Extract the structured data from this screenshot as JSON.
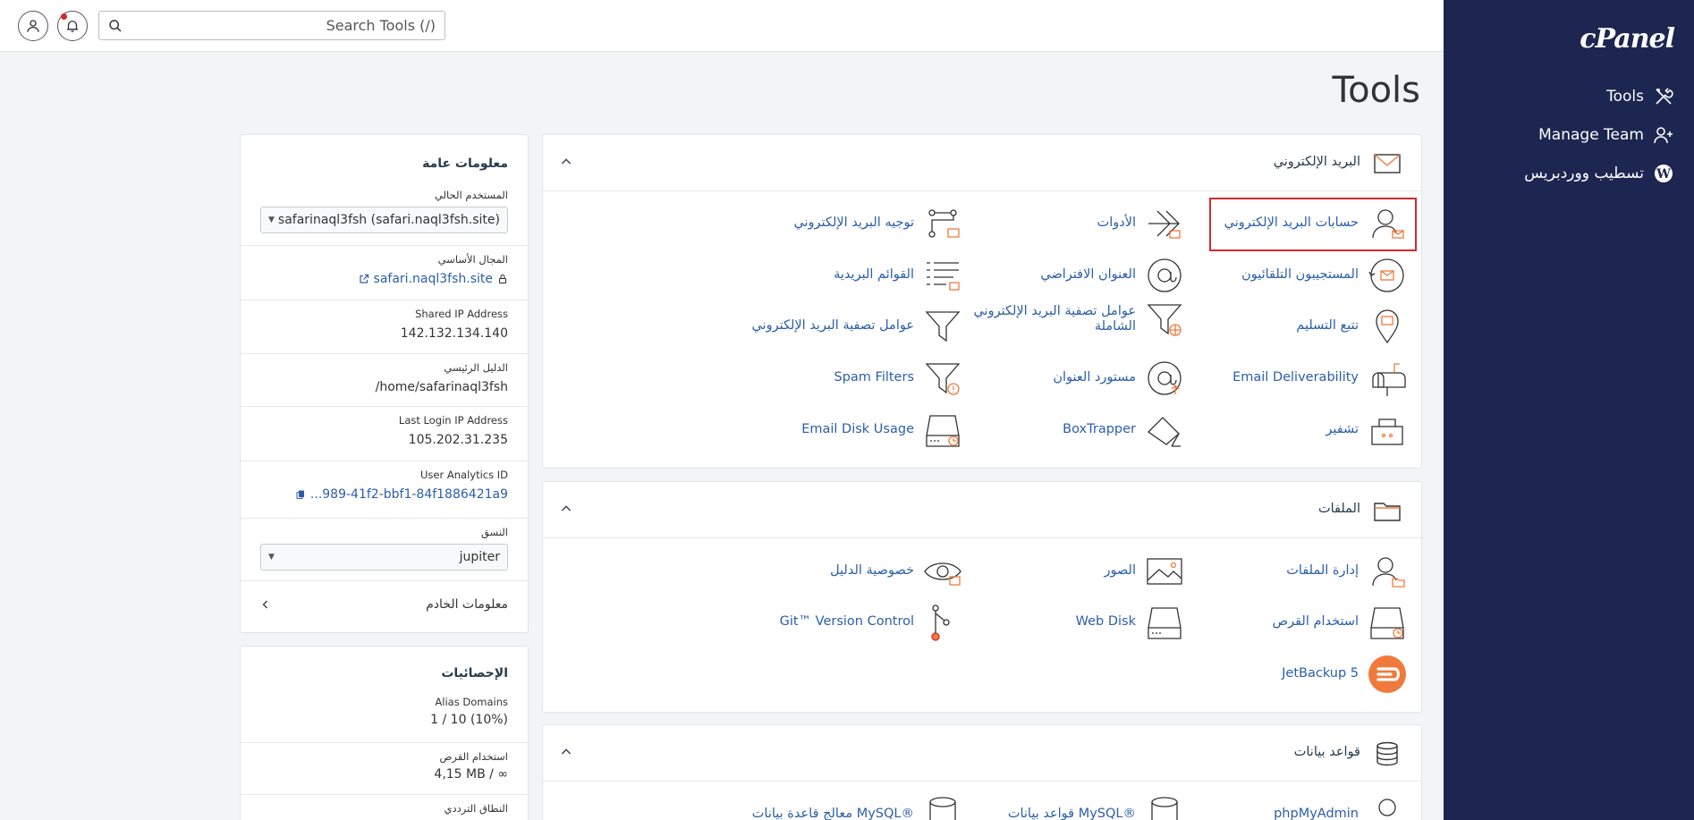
{
  "brand": {
    "logo": "cPanel"
  },
  "sidebar": {
    "items": [
      {
        "label": "Tools",
        "icon": "tools-icon"
      },
      {
        "label": "Manage Team",
        "icon": "user-plus-icon"
      },
      {
        "label": "تسطيب ووردبريس",
        "icon": "wordpress-icon"
      }
    ]
  },
  "topbar": {
    "search_placeholder": "Search Tools (/)"
  },
  "page": {
    "title": "Tools"
  },
  "general_info": {
    "title": "معلومات عامة",
    "current_user_label": "المستخدم الحالي",
    "current_user_value": "safarinaql3fsh (safari.naql3fsh.site)",
    "primary_domain_label": "المجال الأساسي",
    "primary_domain_value": "safari.naql3fsh.site",
    "shared_ip_label": "Shared IP Address",
    "shared_ip_value": "142.132.134.140",
    "home_dir_label": "الدليل الرئيسي",
    "home_dir_value": "/home/safarinaql3fsh",
    "last_login_label": "Last Login IP Address",
    "last_login_value": "105.202.31.235",
    "analytics_label": "User Analytics ID",
    "analytics_value": "...989-41f2-bbf1-84f1886421a9",
    "theme_label": "النسق",
    "theme_value": "jupiter",
    "server_info_label": "معلومات الخادم"
  },
  "statistics": {
    "title": "الإحصائيات",
    "alias_domains_label": "Alias Domains",
    "alias_domains_value": "1 / 10   (10%)",
    "disk_usage_label": "استخدام القرص",
    "disk_usage_value": "4,15 MB / ∞",
    "bandwidth_label": "النطاق الترددي"
  },
  "groups": {
    "email": {
      "title": "البريد الإلكتروني",
      "tools": [
        {
          "label": "حسابات البريد الإلكتروني",
          "icon": "email-accounts-icon",
          "selected": true
        },
        {
          "label": "الأدوات",
          "icon": "forwarders-icon"
        },
        {
          "label": "توجيه البريد الإلكتروني",
          "icon": "email-routing-icon"
        },
        {
          "label": "المستجيبون التلقائيون",
          "icon": "autoresponders-icon"
        },
        {
          "label": "العنوان الافتراضي",
          "icon": "default-address-icon"
        },
        {
          "label": "القوائم البريدية",
          "icon": "mailing-lists-icon"
        },
        {
          "label": "تتبع التسليم",
          "icon": "track-delivery-icon"
        },
        {
          "label": "عوامل تصفية البريد الإلكتروني الشاملة",
          "icon": "global-filters-icon"
        },
        {
          "label": "عوامل تصفية البريد الإلكتروني",
          "icon": "email-filters-icon"
        },
        {
          "label": "Email Deliverability",
          "icon": "mailbox-icon"
        },
        {
          "label": "مستورد العنوان",
          "icon": "address-importer-icon"
        },
        {
          "label": "Spam Filters",
          "icon": "spam-filters-icon"
        },
        {
          "label": "تشفير",
          "icon": "encryption-icon"
        },
        {
          "label": "BoxTrapper",
          "icon": "boxtrapper-icon"
        },
        {
          "label": "Email Disk Usage",
          "icon": "email-disk-usage-icon"
        }
      ]
    },
    "files": {
      "title": "الملفات",
      "tools": [
        {
          "label": "إدارة الملفات",
          "icon": "file-manager-icon"
        },
        {
          "label": "الصور",
          "icon": "images-icon"
        },
        {
          "label": "خصوصية الدليل",
          "icon": "directory-privacy-icon"
        },
        {
          "label": "استخدام القرص",
          "icon": "disk-usage-icon"
        },
        {
          "label": "Web Disk",
          "icon": "web-disk-icon"
        },
        {
          "label": "Git™ Version Control",
          "icon": "git-icon"
        },
        {
          "label": "JetBackup 5",
          "icon": "jetbackup-icon"
        }
      ]
    },
    "databases": {
      "title": "قواعد بيانات",
      "tools": [
        {
          "label": "phpMyAdmin",
          "icon": "phpmyadmin-icon"
        },
        {
          "label": "قواعد بيانات MySQL®",
          "icon": "mysql-databases-icon"
        },
        {
          "label": "معالج قاعدة بيانات MySQL®",
          "icon": "mysql-wizard-icon"
        }
      ]
    }
  },
  "colors": {
    "sidebar_bg": "#1c2650",
    "link": "#2c5ea8",
    "accent_orange": "#f07a3c",
    "selected_outline": "#d12b2b"
  }
}
